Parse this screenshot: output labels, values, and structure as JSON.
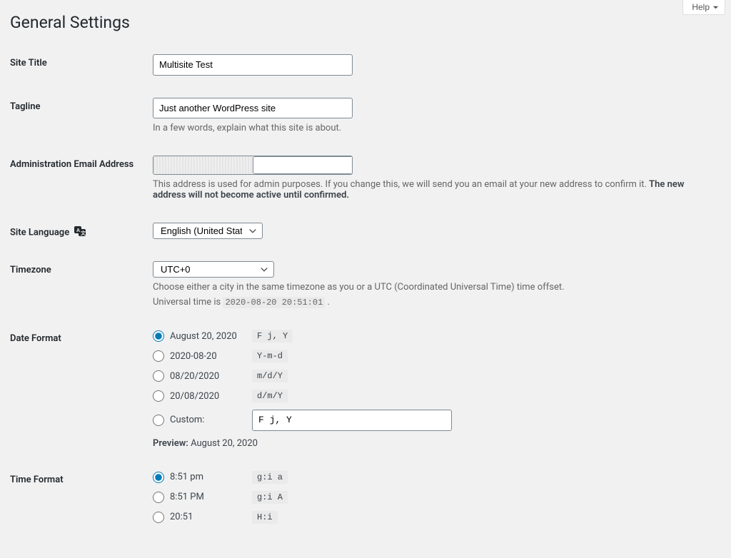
{
  "help": {
    "label": "Help"
  },
  "page_title": "General Settings",
  "site_title": {
    "label": "Site Title",
    "value": "Multisite Test"
  },
  "tagline": {
    "label": "Tagline",
    "value": "Just another WordPress site",
    "desc": "In a few words, explain what this site is about."
  },
  "admin_email": {
    "label": "Administration Email Address",
    "desc_a": "This address is used for admin purposes. If you change this, we will send you an email at your new address to confirm it. ",
    "desc_b": "The new address will not become active until confirmed."
  },
  "site_language": {
    "label": "Site Language",
    "value": "English (United States)"
  },
  "timezone": {
    "label": "Timezone",
    "value": "UTC+0",
    "desc": "Choose either a city in the same timezone as you or a UTC (Coordinated Universal Time) time offset.",
    "universal_prefix": "Universal time is ",
    "universal_value": "2020-08-20 20:51:01",
    "universal_suffix": " ."
  },
  "date_format": {
    "label": "Date Format",
    "options": [
      {
        "label": "August 20, 2020",
        "code": "F j, Y",
        "checked": true
      },
      {
        "label": "2020-08-20",
        "code": "Y-m-d",
        "checked": false
      },
      {
        "label": "08/20/2020",
        "code": "m/d/Y",
        "checked": false
      },
      {
        "label": "20/08/2020",
        "code": "d/m/Y",
        "checked": false
      }
    ],
    "custom_label": "Custom:",
    "custom_value": "F j, Y",
    "preview_label": "Preview:",
    "preview_value": "August 20, 2020"
  },
  "time_format": {
    "label": "Time Format",
    "options": [
      {
        "label": "8:51 pm",
        "code": "g:i a",
        "checked": true
      },
      {
        "label": "8:51 PM",
        "code": "g:i A",
        "checked": false
      },
      {
        "label": "20:51",
        "code": "H:i",
        "checked": false
      }
    ]
  }
}
